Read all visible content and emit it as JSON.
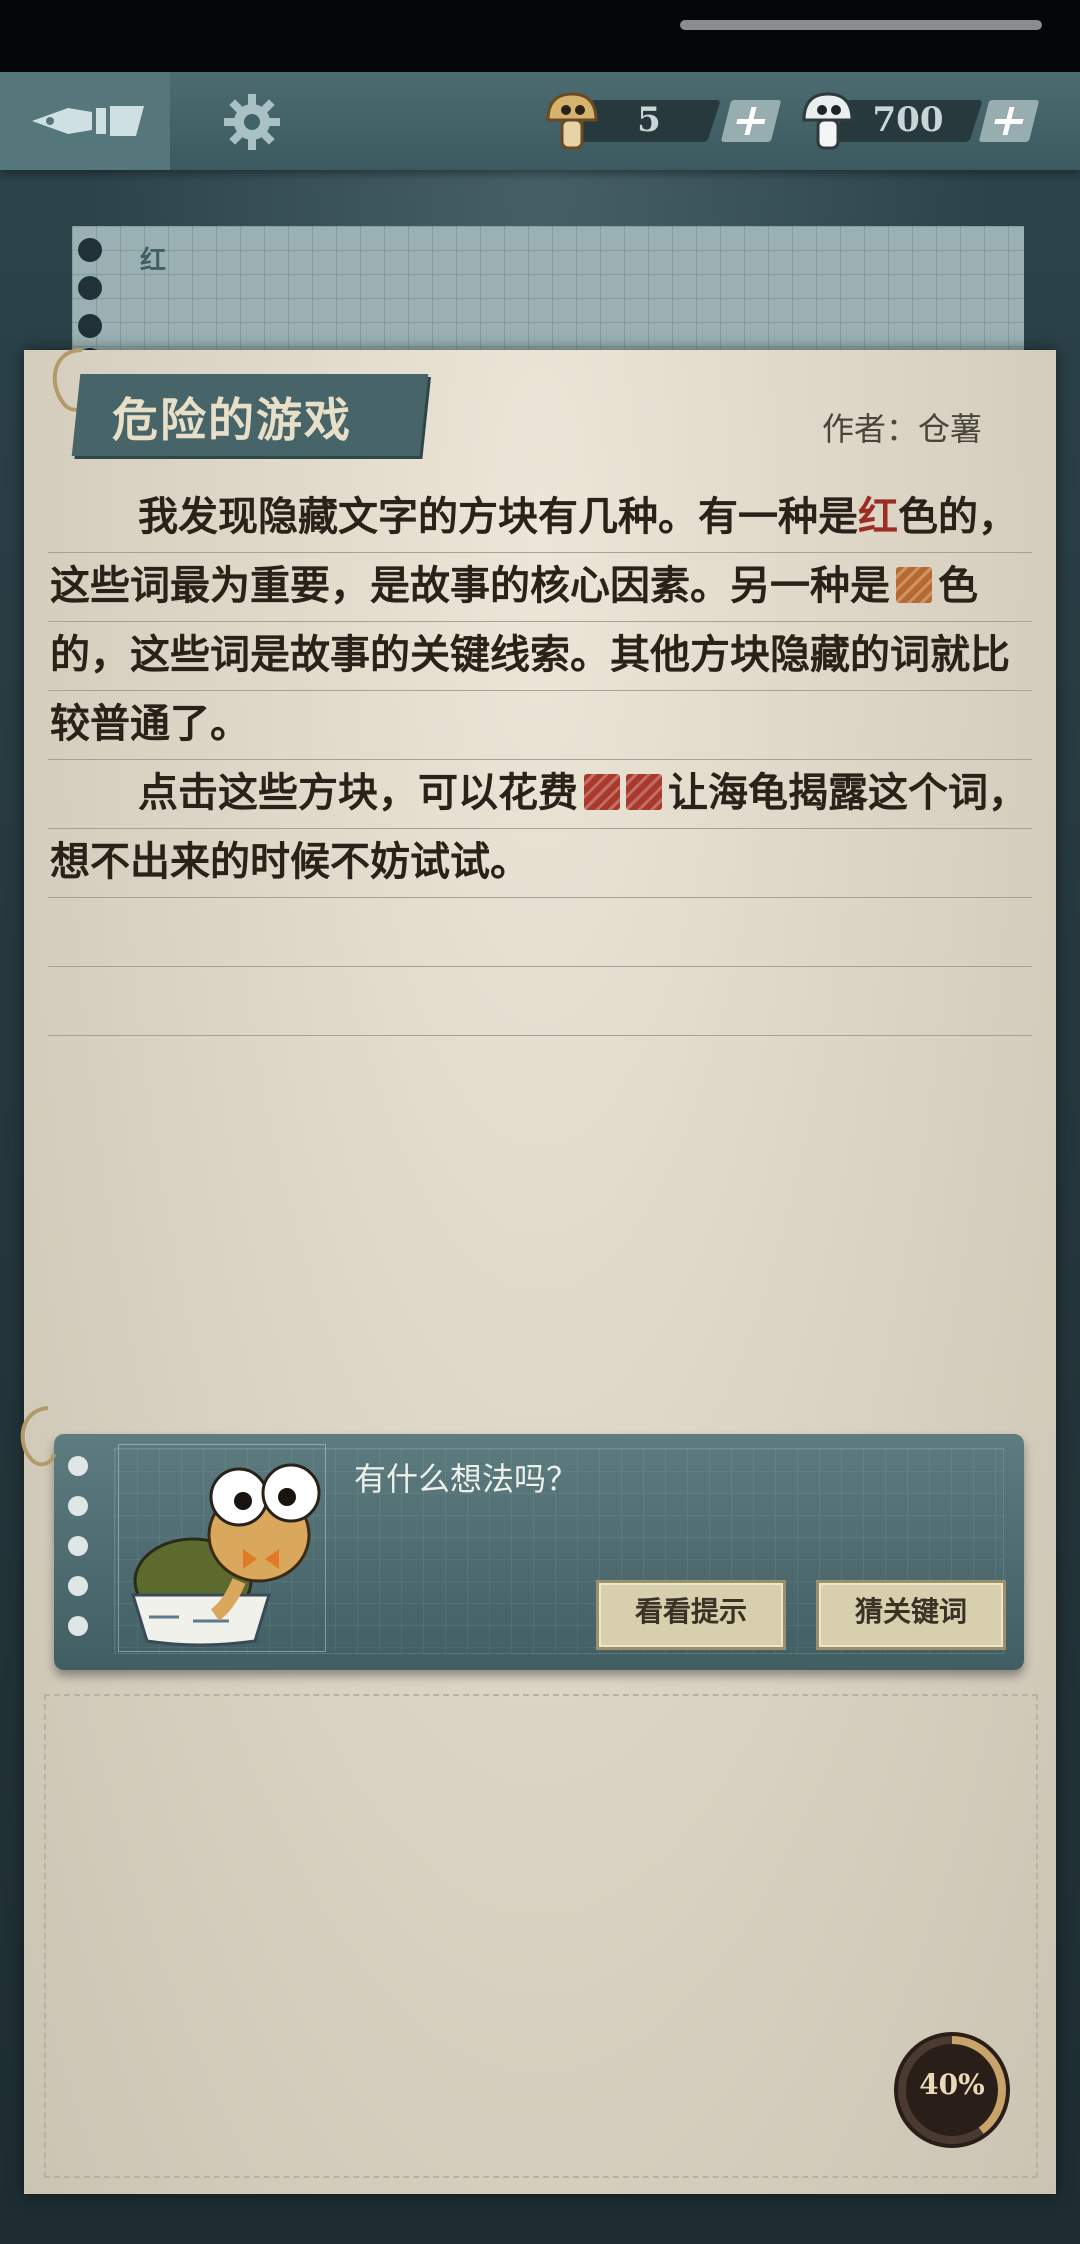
{
  "hud": {
    "hint_currency": {
      "value": "5",
      "icon": "tan-mushroom-icon"
    },
    "coin_currency": {
      "value": "700",
      "icon": "white-mushroom-icon"
    }
  },
  "back_sheet": {
    "label": "红"
  },
  "story": {
    "title": "危险的游戏",
    "author": "作者：仓薯",
    "p1_a": "我发现隐藏文字的方块有几种。有一种是",
    "p1_red": "红",
    "p1_b": "色的，这些词最为重要，是故事的核心因素。另一种是",
    "p1_c": "色的，这些词是故事的关键线索。其他方块隐藏的词就比较普通了。",
    "p2_a": "点击这些方块，可以花费",
    "p2_b": "让海龟揭露这个词，想不出来的时候不妨试试。"
  },
  "dialog": {
    "prompt": "有什么想法吗？",
    "hint_button": "看看提示",
    "guess_button": "猜关键词"
  },
  "progress": {
    "label": "40%",
    "fraction": 0.4
  },
  "colors": {
    "core_tile": "#a8392c",
    "clue_tile": "#b8692f",
    "panel": "#476468"
  }
}
